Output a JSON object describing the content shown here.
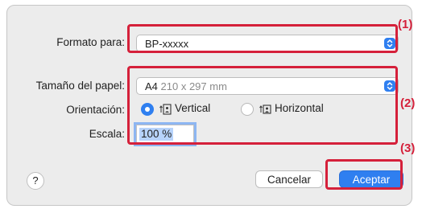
{
  "format": {
    "label": "Formato para:",
    "value": "BP-xxxxx"
  },
  "paper_size": {
    "label": "Tamaño del papel:",
    "value": "A4",
    "detail": "210 x 297 mm"
  },
  "orientation": {
    "label": "Orientación:",
    "options": [
      {
        "label": "Vertical",
        "selected": true
      },
      {
        "label": "Horizontal",
        "selected": false
      }
    ]
  },
  "scale": {
    "label": "Escala:",
    "value": "100 %"
  },
  "buttons": {
    "help": "?",
    "cancel": "Cancelar",
    "accept": "Aceptar"
  },
  "callouts": [
    "(1)",
    "(2)",
    "(3)"
  ],
  "colors": {
    "accent": "#2f7ff0",
    "callout": "#d5203a"
  }
}
